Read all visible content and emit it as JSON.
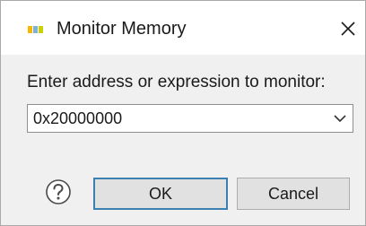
{
  "window": {
    "title": "Monitor Memory",
    "app_icon": "nxp-logo-icon",
    "close_icon": "close-icon"
  },
  "form": {
    "prompt": "Enter address or expression to monitor:",
    "address_value": "0x20000000",
    "dropdown_icon": "chevron-down-icon"
  },
  "buttons": {
    "help_icon": "help-icon",
    "ok_label": "OK",
    "cancel_label": "Cancel"
  },
  "colors": {
    "default_button_border": "#3c7fb1",
    "logo_yellow": "#f9b500",
    "logo_blue": "#7bb1db",
    "logo_green": "#c9d200"
  }
}
